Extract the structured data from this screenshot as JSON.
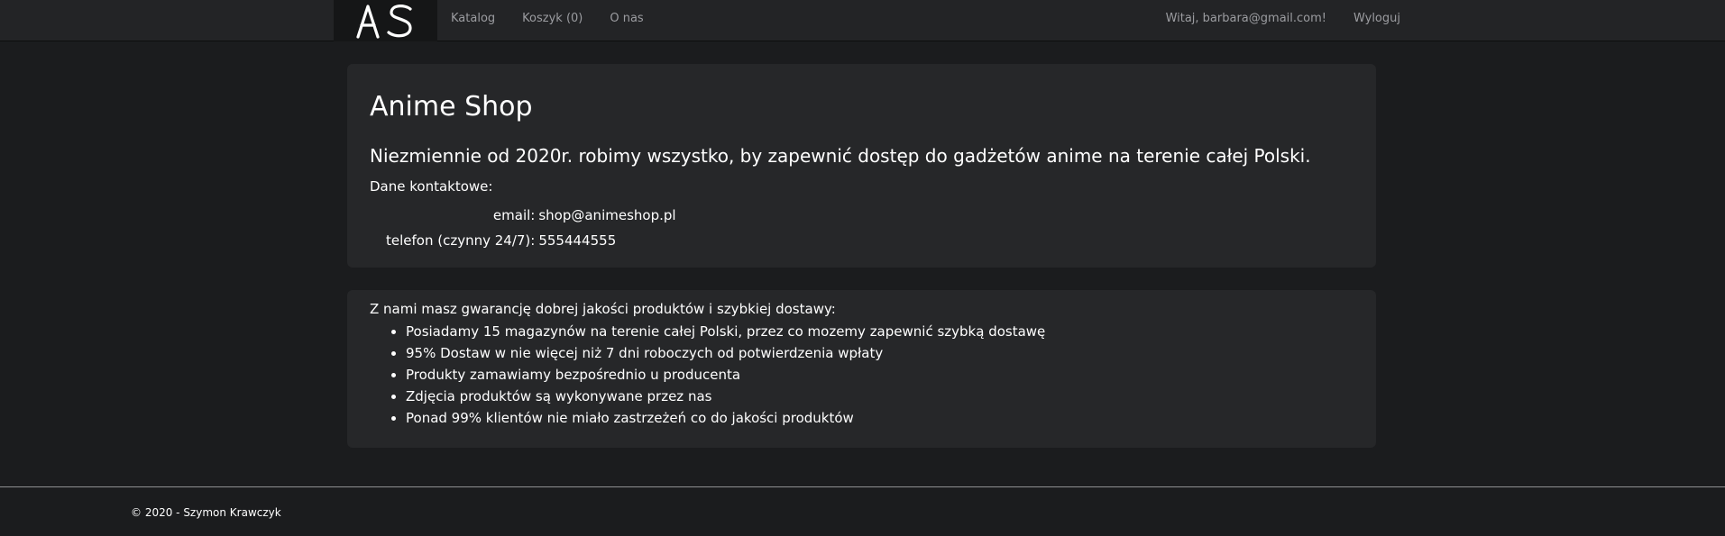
{
  "navbar": {
    "brand_text": "AS",
    "links": [
      "Katalog",
      "Koszyk (0)",
      "O nas"
    ],
    "greeting": "Witaj, barbara@gmail.com!",
    "logout": "Wyloguj"
  },
  "about": {
    "title": "Anime Shop",
    "tagline": "Niezmiennie od 2020r. robimy wszystko, by zapewnić dostęp do gadżetów anime na terenie całej Polski.",
    "contact_heading": "Dane kontaktowe:",
    "contacts": [
      {
        "label": "email:",
        "value": "shop@animeshop.pl"
      },
      {
        "label": "telefon (czynny 24/7):",
        "value": "555444555"
      }
    ]
  },
  "guarantee": {
    "intro": "Z nami masz gwarancję dobrej jakości produktów i szybkiej dostawy:",
    "items": [
      "Posiadamy 15 magazynów na terenie całej Polski, przez co mozemy zapewnić szybką dostawę",
      "95% Dostaw w nie więcej niż 7 dni roboczych od potwierdzenia wpłaty",
      "Produkty zamawiamy bezpośrednio u producenta",
      "Zdjęcia produktów są wykonywane przez nas",
      "Ponad 99% klientów nie miało zastrzeżeń co do jakości produktów"
    ]
  },
  "footer": {
    "text": "© 2020 - Szymon Krawczyk"
  },
  "colors": {
    "page_background": "#1b1c1e",
    "navbar_background": "#232426",
    "brand_background": "#151617",
    "panel_background": "#262729",
    "nav_link_text": "#9b9ca0",
    "text": "#ffffff"
  }
}
